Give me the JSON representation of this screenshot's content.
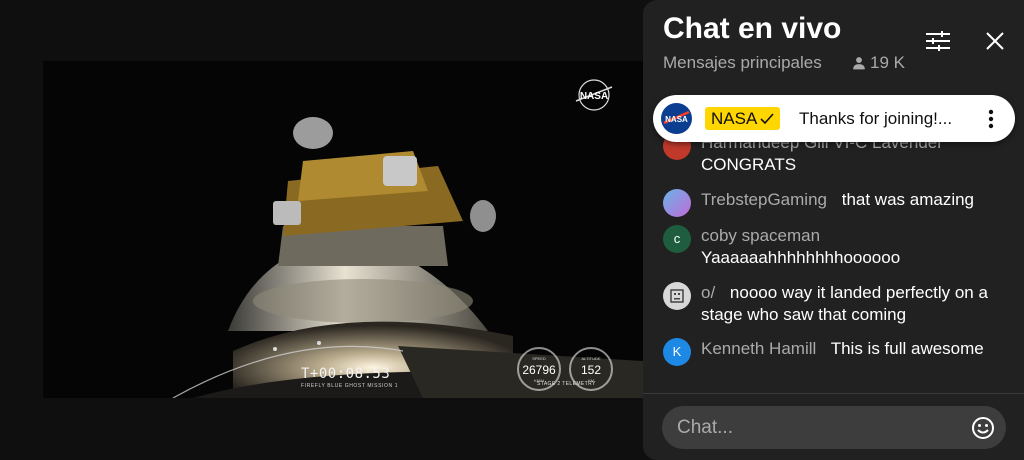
{
  "video": {
    "watermark": "NASA",
    "telemetry": {
      "timer": "T+00:08:53",
      "mission": "FIREFLY BLUE GHOST MISSION 1",
      "speed_label": "SPEED",
      "speed_value": "26796",
      "speed_unit": "KM/H",
      "altitude_label": "ALTITUDE",
      "altitude_value": "152",
      "altitude_unit": "KM",
      "stage_label": "STAGE 2 TELEMETRY"
    }
  },
  "chat": {
    "title": "Chat en vivo",
    "subtitle": "Mensajes principales",
    "viewer_count": "19 K",
    "icons": {
      "filter": "tune-icon",
      "close": "close-icon",
      "person": "person-icon",
      "emoji": "emoji-icon",
      "menu": "more-vert-icon"
    },
    "pinned": {
      "author": "NASA",
      "text": "Thanks for joining!..."
    },
    "messages": [
      {
        "author": "Harmandeep Gill VI-C Lavender",
        "text": "CONGRATS",
        "avatar_color": "#c0392b",
        "initial": ""
      },
      {
        "author": "TrebstepGaming",
        "text": "that was amazing",
        "avatar_color": "#6ab4e8",
        "initial": ""
      },
      {
        "author": "coby spaceman",
        "text": "Yaaaaaahhhhhhhhoooooo",
        "avatar_color": "#1e5e3f",
        "initial": "c"
      },
      {
        "author": "o/",
        "text": "noooo way it landed perfectly on a stage who saw that coming",
        "avatar_color": "#d8d8d8",
        "initial": ""
      },
      {
        "author": "Kenneth Hamill",
        "text": "This is full awesome",
        "avatar_color": "#1e88e5",
        "initial": "K"
      }
    ],
    "input_placeholder": "Chat..."
  },
  "colors": {
    "accent_badge": "#ffd600",
    "panel_bg": "#212121",
    "video_bg": "#0f0f0f"
  }
}
